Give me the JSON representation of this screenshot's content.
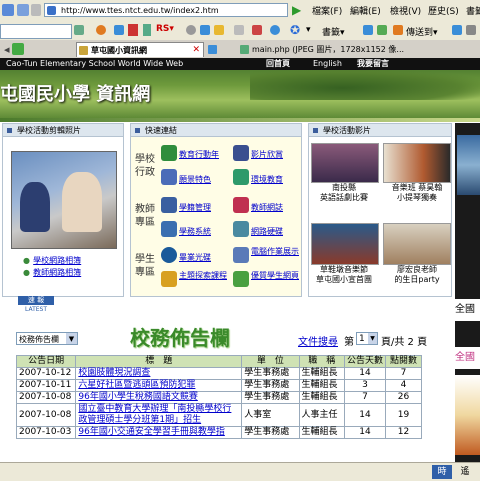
{
  "browser": {
    "url": "http://www.ttes.ntct.edu.tw/index2.htm",
    "menu_items": [
      "檔案(F)",
      "編輯(E)",
      "檢視(V)",
      "歷史(S)",
      "書籤"
    ],
    "tabs": [
      {
        "label": "草屯國小資訊網",
        "active": true
      },
      {
        "label": "",
        "active": false
      },
      {
        "label": "main.php (JPEG 圖片，1728x1152 像...",
        "active": false
      }
    ],
    "toolbar": {
      "bookmarks_label": "書籤▾",
      "send_link_label": "傳送到▾",
      "rs_label": "RS▾"
    }
  },
  "site": {
    "nav_english": "Cao-Tun Elementary School  World Wide Web",
    "nav_links": [
      "回首頁",
      "English",
      "我要留言"
    ],
    "title": "屯國民小學 資訊網"
  },
  "left_panel": {
    "title": "學校活動剪輯照片",
    "links": [
      "學校網路相簿",
      "教師網路相簿"
    ]
  },
  "quick_links": {
    "title": "快速連結",
    "sections": [
      {
        "label": "學校\n行政",
        "items": [
          "教育行動年",
          "影片欣賞",
          "願景特色",
          "環境教育"
        ]
      },
      {
        "label": "教師\n專區",
        "items": [
          "學籍管理",
          "教師網誌",
          "學務系統",
          "網路硬碟"
        ]
      },
      {
        "label": "學生\n專區",
        "items": [
          "畢業光碟",
          "電腦作業展示",
          "主題探索課程",
          "優質學生網頁"
        ]
      }
    ],
    "icon_colors": [
      "#2f8d3c",
      "#3a4f8f",
      "#4b6cb8",
      "#2e9a6a",
      "#3a5fa0",
      "#c03050",
      "#3b6fb0",
      "#4a8aa0",
      "#1a5a9a",
      "#5a7ab8",
      "#d8a020",
      "#4aa040"
    ]
  },
  "video_panel": {
    "title": "學校活動影片",
    "videos": [
      {
        "caption": "南投縣\n英語話劇比賽"
      },
      {
        "caption": "音樂班 蔡昊翰\n小提琴獨奏"
      },
      {
        "caption": "草鞋墩音樂節\n草屯國小宣首團"
      },
      {
        "caption": "廖宏良老師\n的生日party"
      }
    ]
  },
  "news_badge": {
    "line1": "速 報",
    "line2": "LATEST"
  },
  "announcements": {
    "category_select": "校務佈告欄",
    "title": "校務佈告欄",
    "search_link": "文件搜尋",
    "page_prefix": "第",
    "page_value": "1",
    "page_suffix": "頁/共 2 頁",
    "columns": [
      "公告日期",
      "標　題",
      "單　位",
      "職　稱",
      "公告天數",
      "點閱數"
    ],
    "rows": [
      {
        "date": "2007-10-12",
        "title": "校園肢體現況調查",
        "unit": "學生事務處",
        "role": "生輔組長",
        "days": "14",
        "views": "7"
      },
      {
        "date": "2007-10-11",
        "title": "六星好社區暨逃頭區預防犯罪",
        "unit": "學生事務處",
        "role": "生輔組長",
        "days": "3",
        "views": "4"
      },
      {
        "date": "2007-10-08",
        "title": "96年國小學生稅務國語文競賽",
        "unit": "學生事務處",
        "role": "生輔組長",
        "days": "7",
        "views": "26"
      },
      {
        "date": "2007-10-08",
        "title": "國立臺中教育大學辦理「南投縣學校行政管理碩士學分班第1期」招生",
        "unit": "人事室",
        "role": "人事主任",
        "days": "14",
        "views": "19"
      },
      {
        "date": "2007-10-03",
        "title": "96年國小交通安全學習手冊與教學指",
        "unit": "學生事務處",
        "role": "生輔組長",
        "days": "14",
        "views": "12"
      }
    ]
  },
  "right_edge": {
    "label1": "全國",
    "label2": "全國"
  },
  "status_bar": {
    "text": "時",
    "text2": "遙"
  }
}
